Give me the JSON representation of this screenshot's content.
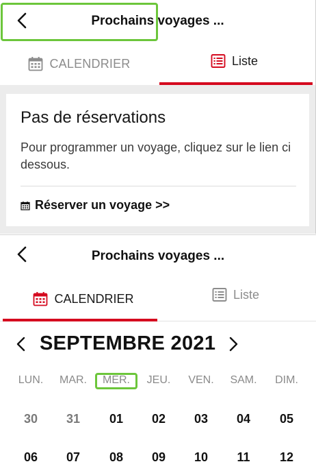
{
  "screens": [
    {
      "header": {
        "title": "Prochains voyages ...",
        "back_icon": "chevron-left-icon"
      },
      "tabs": [
        {
          "label": "CALENDRIER",
          "icon": "calendar-icon",
          "active": false
        },
        {
          "label": "Liste",
          "icon": "list-icon",
          "active": true
        }
      ],
      "card": {
        "title": "Pas de réservations",
        "text": "Pour programmer un voyage, cliquez sur le lien ci dessous.",
        "link_label": "Réserver un voyage >>",
        "link_icon": "calendar-small-icon"
      }
    },
    {
      "header": {
        "title": "Prochains voyages ...",
        "back_icon": "chevron-left-icon"
      },
      "tabs": [
        {
          "label": "CALENDRIER",
          "icon": "calendar-icon",
          "active": true
        },
        {
          "label": "Liste",
          "icon": "list-icon",
          "active": false
        }
      ],
      "calendar": {
        "month_label": "SEPTEMBRE 2021",
        "weekdays": [
          "LUN.",
          "MAR.",
          "MER.",
          "JEU.",
          "VEN.",
          "SAM.",
          "DIM."
        ],
        "weeks": [
          [
            "30",
            "31",
            "01",
            "02",
            "03",
            "04",
            "05"
          ],
          [
            "06",
            "07",
            "08",
            "09",
            "10",
            "11",
            "12"
          ]
        ],
        "outside_month_days": [
          "30",
          "31"
        ]
      }
    }
  ],
  "colors": {
    "accent_red": "#d50a1f",
    "highlight_green": "#6cc63b",
    "muted_text": "#8c8c8c",
    "background_gray": "#ececec"
  }
}
